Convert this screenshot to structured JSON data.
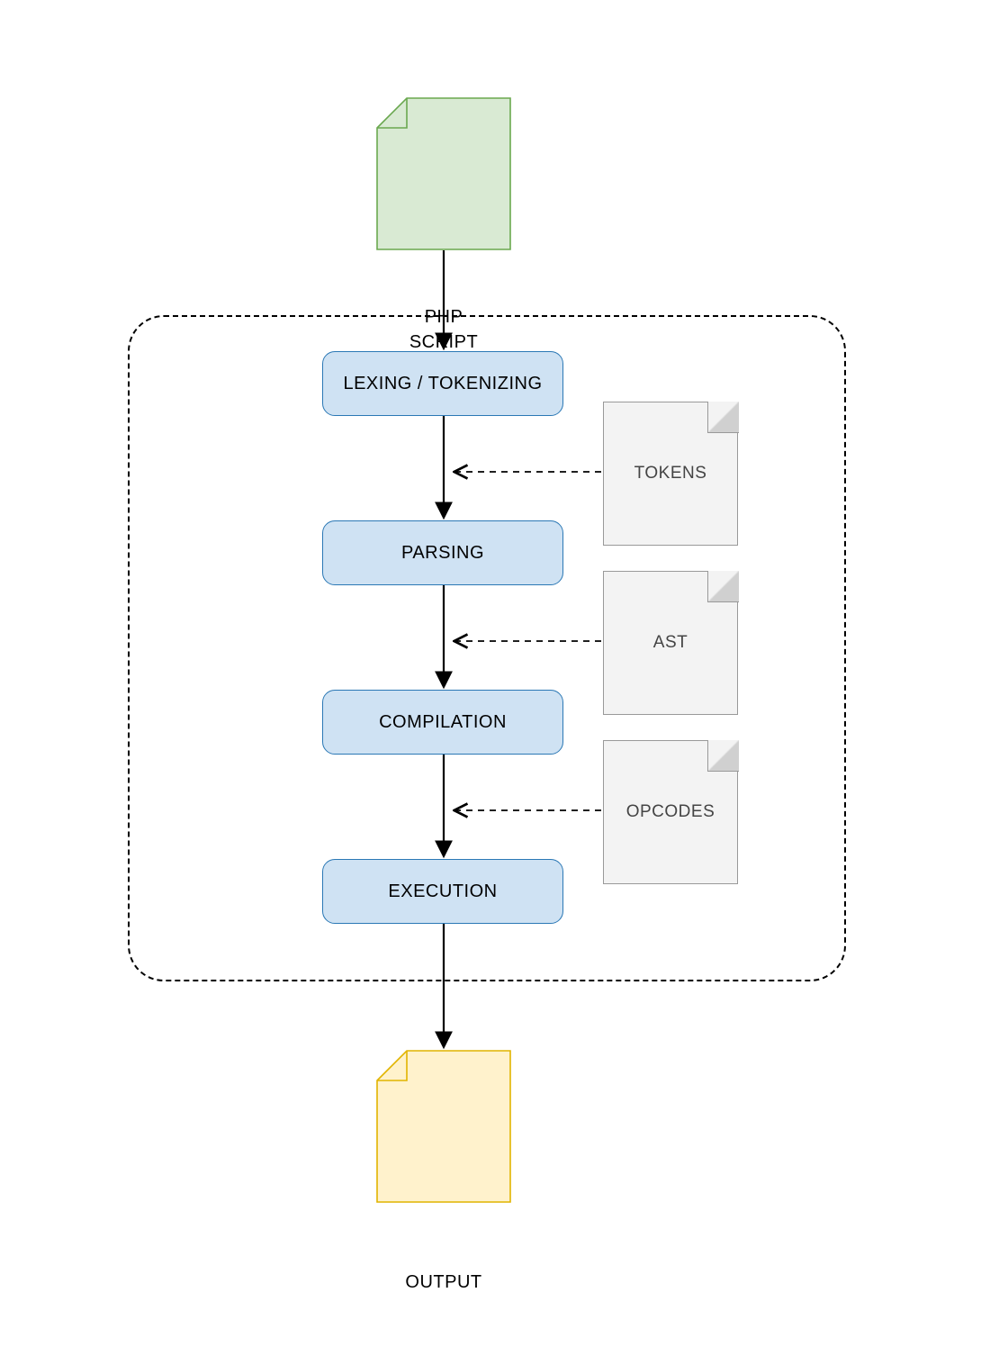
{
  "input_doc": {
    "label1": "PHP",
    "label2": "SCRIPT"
  },
  "output_doc": {
    "label": "OUTPUT"
  },
  "stages": {
    "lexing": "LEXING / TOKENIZING",
    "parsing": "PARSING",
    "compilation": "COMPILATION",
    "execution": "EXECUTION"
  },
  "artifacts": {
    "tokens": "TOKENS",
    "ast": "AST",
    "opcodes": "OPCODES"
  },
  "colors": {
    "green_fill": "#d9ead3",
    "green_stroke": "#6aa84f",
    "yellow_fill": "#fff2cc",
    "yellow_stroke": "#e1b400",
    "blue_fill": "#cfe2f3",
    "blue_stroke": "#2b78b5",
    "note_fill": "#f3f3f3",
    "note_stroke": "#999999"
  }
}
